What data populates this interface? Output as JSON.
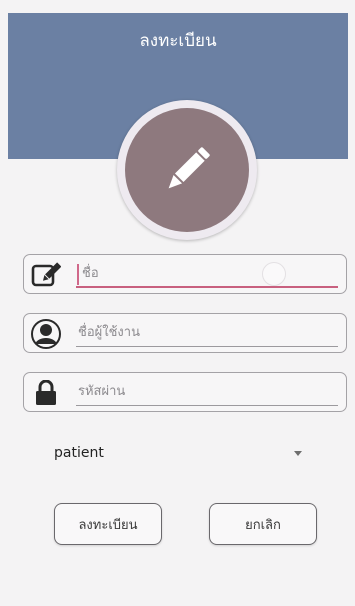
{
  "app_bar": {
    "title": "ลงทะเบียน"
  },
  "form": {
    "name_field": {
      "placeholder": "ชื่อ",
      "icon": "edit-icon",
      "focused": true
    },
    "username_field": {
      "placeholder": "ชื่อผู้ใช้งาน",
      "icon": "user-icon"
    },
    "password_field": {
      "placeholder": "รหัสผ่าน",
      "icon": "lock-icon"
    },
    "role_dropdown": {
      "selected": "patient"
    }
  },
  "buttons": {
    "register_label": "ลงทะเบียน",
    "cancel_label": "ยกเลิก"
  },
  "colors": {
    "header": "#6b80a3",
    "avatar": "#8e797e",
    "focus_accent": "#c8607f"
  }
}
